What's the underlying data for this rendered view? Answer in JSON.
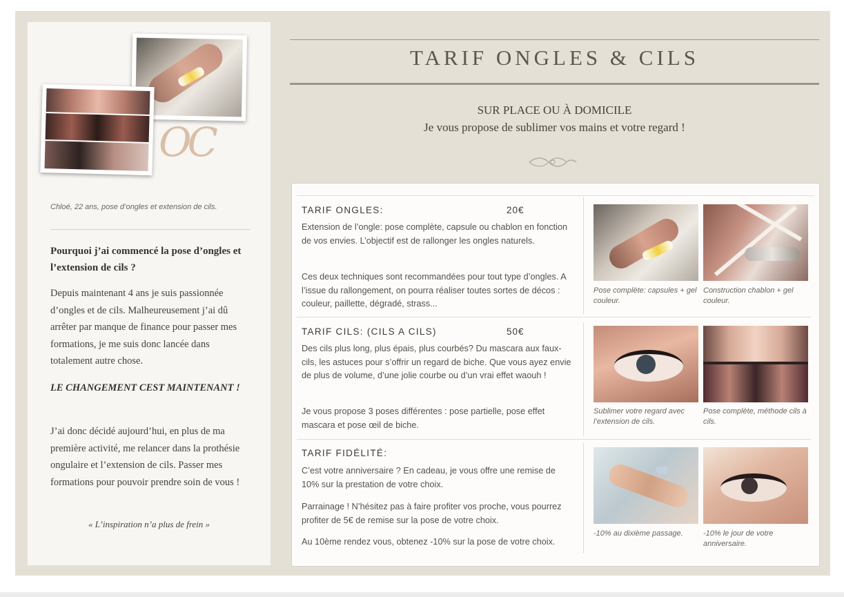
{
  "left_panel": {
    "monogram": "OC",
    "caption": "Chloé, 22 ans, pose d’ongles et extension de cils.",
    "heading": "Pourquoi j’ai commencé la pose d’ongles et l’extension de cils ?",
    "paragraph1": "Depuis maintenant 4 ans je suis passionnée d’ongles et de cils. Malheureusement j’ai dû arrêter par manque de finance pour passer mes formations, je me suis donc lancée dans totalement autre chose.",
    "cta": "Le changement cest maintenant !",
    "paragraph2": "J’ai donc décidé aujourd’hui, en plus de ma première activité, me relancer dans la prothésie ongulaire et l’extension de cils. Passer mes formations pour pouvoir prendre soin de vous !",
    "quote": "« L’inspiration n’a plus de frein »"
  },
  "header": {
    "title": "TARIF ONGLES & CILS",
    "subtitle": "SUR PLACE OU À DOMICILE",
    "tagline": "Je vous propose de sublimer vos mains et votre regard !"
  },
  "sections": {
    "ongles": {
      "title": "TARIF ONGLES:",
      "price": "20€",
      "text1": "Extension de l’ongle: pose complète, capsule ou chablon en fonction de vos envies. L’objectif est de rallonger les ongles naturels.",
      "text2": "Ces deux techniques sont recommandées pour tout type d’ongles. A l’issue du rallongement, on pourra réaliser toutes sortes de décos : couleur, paillette, dégradé, strass...",
      "caption1": "Pose complète: capsules + gel couleur.",
      "caption2": "Construction chablon + gel couleur."
    },
    "cils": {
      "title": "TARIF CILS: (CILS A CILS)",
      "price": "50€",
      "text1": "Des cils plus long, plus épais, plus courbés? Du mascara aux faux-cils, les astuces pour s’offrir un regard de biche. Que vous ayez envie de plus de volume, d’une jolie courbe ou d’un vrai effet waouh !",
      "text2": "Je vous propose 3 poses différentes : pose partielle, pose effet mascara et pose œil de biche.",
      "caption1": "Sublimer votre regard avec l’extension de cils.",
      "caption2": "Pose complète, méthode cils à cils."
    },
    "fidelite": {
      "title": "TARIF FIDÉLITÉ:",
      "text1": "C’est votre anniversaire ? En cadeau, je vous offre une remise de 10% sur la prestation de votre choix.",
      "text2": "Parrainage ! N’hésitez pas à faire profiter vos proche, vous pourrez profiter de 5€ de remise sur la pose de votre choix.",
      "text3": "Au 10ème rendez vous, obtenez -10% sur la pose de votre choix.",
      "caption1": "-10% au dixième passage.",
      "caption2": "-10% le jour de votre anniversaire."
    }
  },
  "colors": {
    "background": "#e4e0d5",
    "panel": "#f8f6f2",
    "card": "#fdfcfb",
    "accent_text": "#5b564e",
    "monogram": "#d9bfa8"
  }
}
